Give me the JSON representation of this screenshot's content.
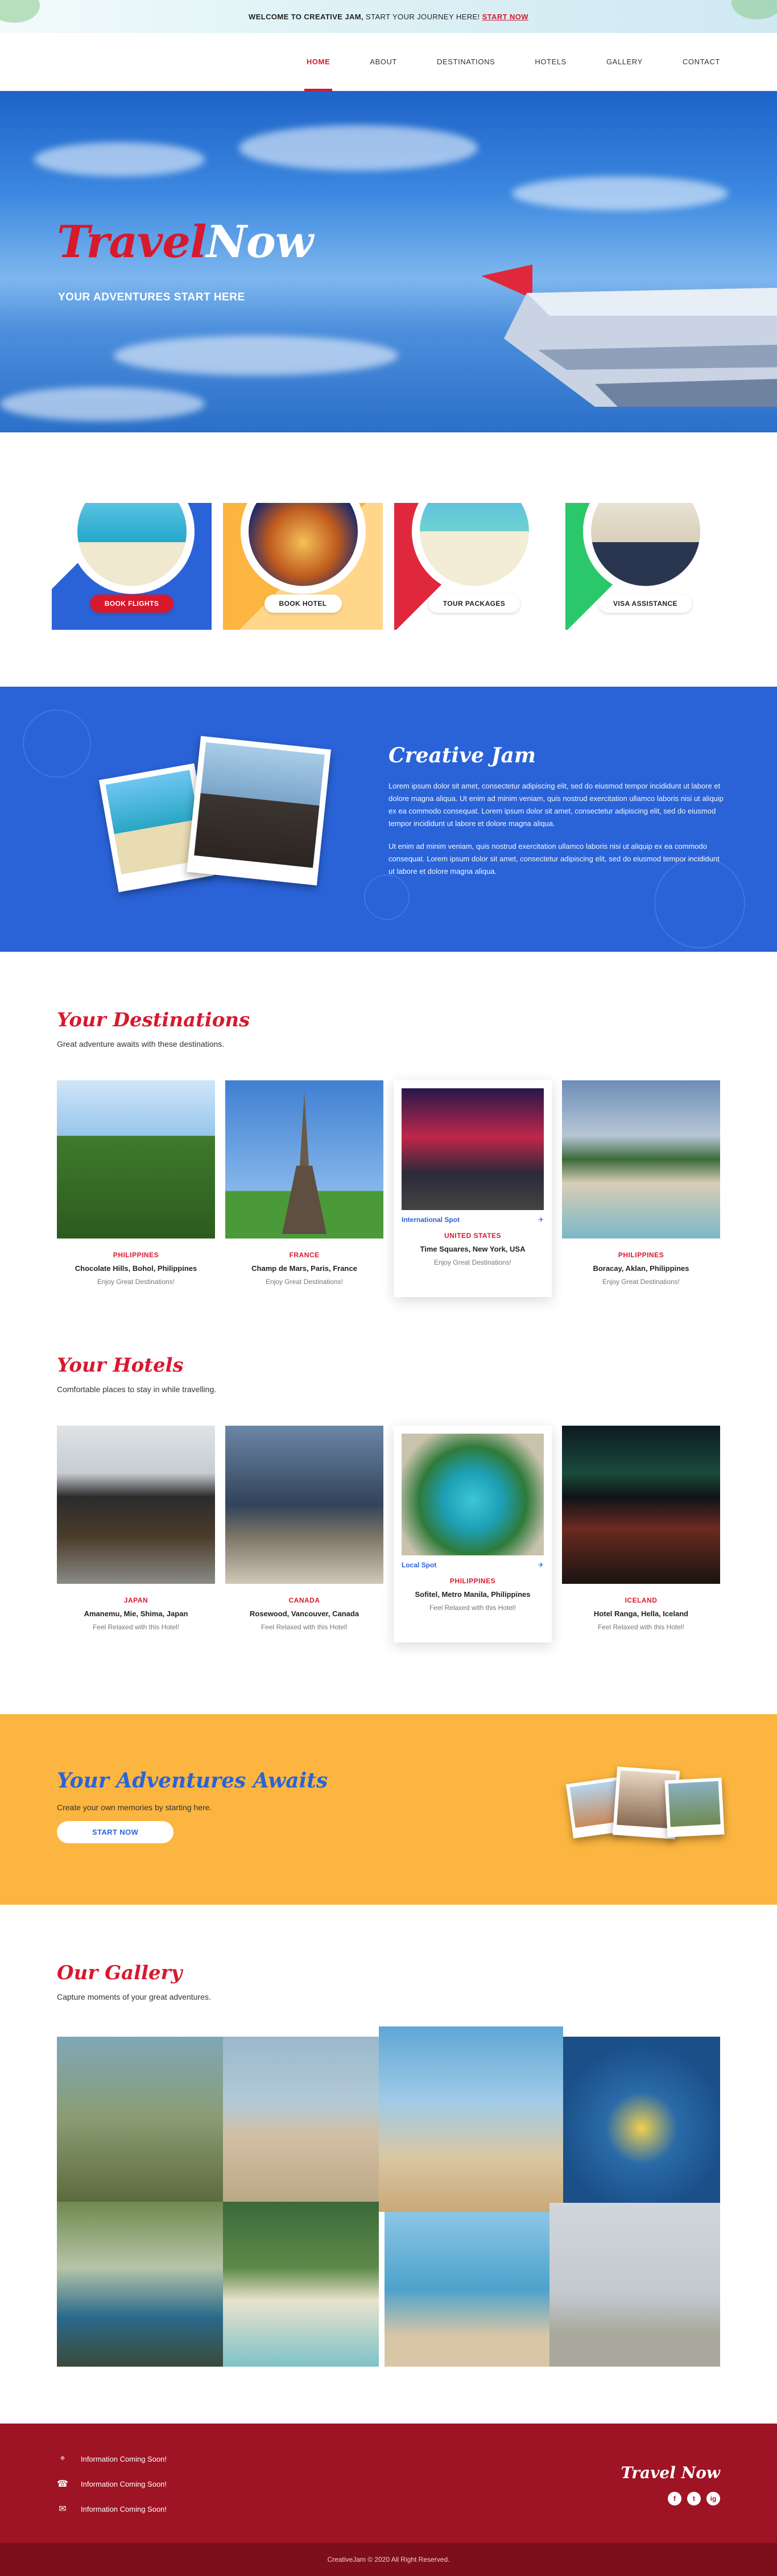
{
  "topbar": {
    "welcome": "WELCOME TO CREATIVE JAM,",
    "journey": "START YOUR JOURNEY HERE!",
    "cta": "START NOW"
  },
  "nav": {
    "items": [
      "HOME",
      "ABOUT",
      "DESTINATIONS",
      "HOTELS",
      "GALLERY",
      "CONTACT"
    ],
    "active": "HOME"
  },
  "hero": {
    "brand_a": "Travel",
    "brand_b": "Now",
    "tagline": "YOUR ADVENTURES START HERE"
  },
  "services": [
    {
      "label": "BOOK FLIGHTS",
      "icon": "plane-icon",
      "color": "#2a63d8"
    },
    {
      "label": "BOOK HOTEL",
      "icon": "hotel-icon",
      "color": "#fbb540"
    },
    {
      "label": "TOUR PACKAGES",
      "icon": "beach-icon",
      "color": "#e0283c"
    },
    {
      "label": "VISA ASSISTANCE",
      "icon": "passport-icon",
      "color": "#2bc76b"
    }
  ],
  "about": {
    "title": "Creative Jam",
    "p1": "Lorem ipsum dolor sit amet, consectetur adipiscing elit, sed do eiusmod tempor incididunt ut labore et dolore magna aliqua. Ut enim ad minim veniam, quis nostrud exercitation ullamco laboris nisi ut aliquip ex ea commodo consequat. Lorem ipsum dolor sit amet, consectetur adipiscing elit, sed do eiusmod tempor incididunt ut labore et dolore magna aliqua.",
    "p2": "Ut enim ad minim veniam, quis nostrud exercitation ullamco laboris nisi ut aliquip ex ea commodo consequat. Lorem ipsum dolor sit amet, consectetur adipiscing elit, sed do eiusmod tempor incididunt ut labore et dolore magna aliqua."
  },
  "destinations": {
    "title": "Your Destinations",
    "subtitle": "Great adventure awaits with these destinations.",
    "cards": [
      {
        "country": "PHILIPPINES",
        "place": "Chocolate Hills, Bohol, Philippines",
        "note": "Enjoy Great Destinations!"
      },
      {
        "country": "FRANCE",
        "place": "Champ de Mars, Paris, France",
        "note": "Enjoy Great Destinations!"
      },
      {
        "country": "UNITED STATES",
        "place": "Time Squares, New York, USA",
        "note": "Enjoy Great Destinations!",
        "spot": "International Spot"
      },
      {
        "country": "PHILIPPINES",
        "place": "Boracay,  Aklan, Philippines",
        "note": "Enjoy Great Destinations!"
      }
    ]
  },
  "hotels": {
    "title": "Your Hotels",
    "subtitle": "Comfortable places to stay in while travelling.",
    "cards": [
      {
        "country": "JAPAN",
        "place": "Amanemu, Mie, Shima, Japan",
        "note": "Feel Relaxed with this Hotel!"
      },
      {
        "country": "CANADA",
        "place": "Rosewood, Vancouver, Canada",
        "note": "Feel Relaxed with this Hotel!"
      },
      {
        "country": "PHILIPPINES",
        "place": "Sofitel, Metro Manila, Philippines",
        "note": "Feel Relaxed with this Hotel!",
        "spot": "Local Spot"
      },
      {
        "country": "ICELAND",
        "place": "Hotel Ranga, Hella, Iceland",
        "note": "Feel Relaxed with this Hotel!"
      }
    ]
  },
  "adventures": {
    "title": "Your Adventures Awaits",
    "subtitle": "Create your own memories by starting here.",
    "button": "START NOW"
  },
  "gallery": {
    "title": "Our Gallery",
    "subtitle": "Capture moments of your great adventures."
  },
  "footer": {
    "info": [
      "Information Coming Soon!",
      "Information Coming Soon!",
      "Information Coming Soon!"
    ],
    "brand": "Travel Now",
    "socials": [
      "f",
      "t",
      "ig"
    ],
    "copyright": "CreativeJam © 2020 All Right Reserved."
  },
  "colors": {
    "accent": "#d7192d",
    "blue": "#2a63d8",
    "yellow": "#fbb540",
    "footer": "#9e1424"
  }
}
